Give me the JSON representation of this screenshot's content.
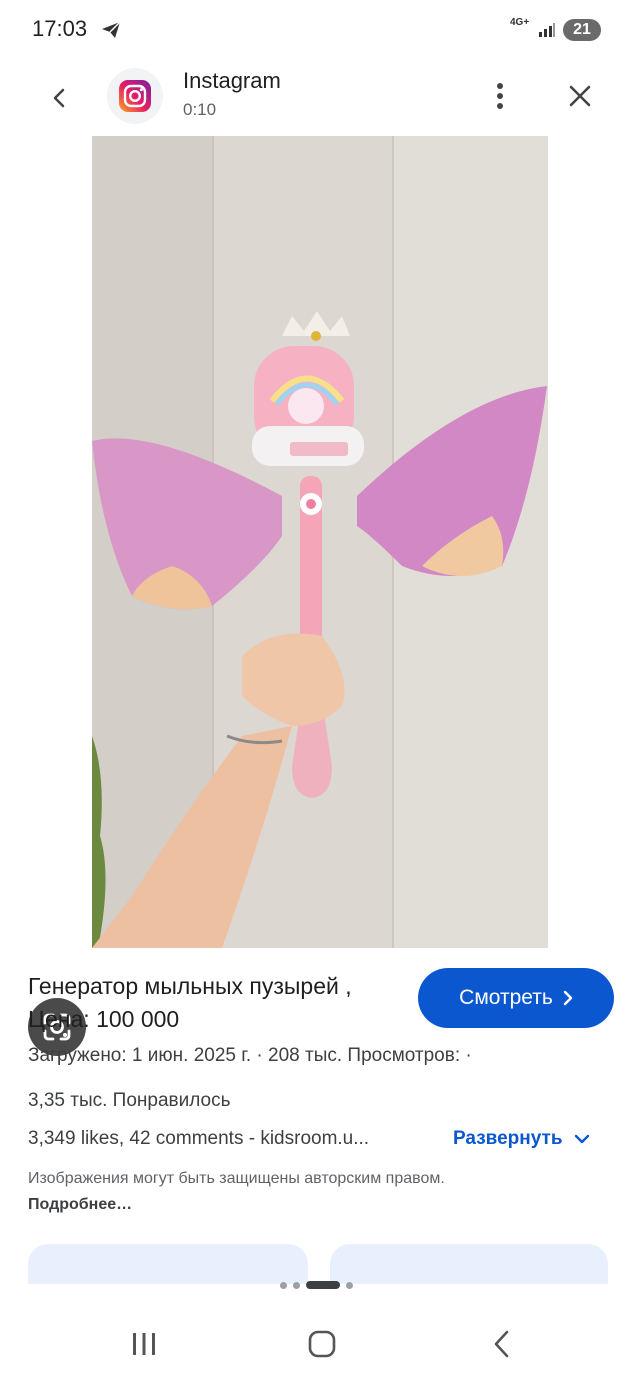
{
  "status_bar": {
    "time": "17:03",
    "network": "4G+",
    "battery_badge": "21",
    "icons": [
      "telegram-icon",
      "signal-icon"
    ]
  },
  "header": {
    "app_name": "Instagram",
    "duration": "0:10",
    "icons": [
      "back-arrow-icon",
      "instagram-logo-icon",
      "more-vert-icon",
      "close-icon"
    ]
  },
  "media": {
    "icons": [
      "google-lens-icon"
    ]
  },
  "result": {
    "title": "Генератор мыльных пузырей , Цена: 100 000",
    "watch_label": "Смотреть",
    "meta_line1": "Загружено: 1 июн. 2025 г.  ·  208 тыс. Просмотров:  ·",
    "meta_line2": "3,35 тыс. Понравилось",
    "description": "3,349 likes, 42 comments - kidsroom.u...",
    "expand_label": "Развернуть",
    "copyright_text": "Изображения могут быть защищены авторским правом.",
    "copyright_link": "Подробнее…"
  },
  "pagination": {
    "total": 5,
    "active": 2
  },
  "nav_bar": {
    "icons": [
      "recents-icon",
      "home-icon",
      "back-icon"
    ]
  },
  "colors": {
    "accent": "#0b57d0",
    "text": "#1f1f1f",
    "muted": "#5f6368"
  }
}
